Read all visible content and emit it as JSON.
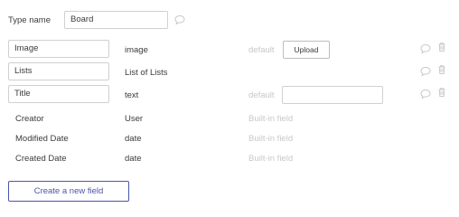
{
  "type_name": {
    "label": "Type name",
    "value": "Board"
  },
  "fields": [
    {
      "name": "Image",
      "type": "image",
      "default_label": "default",
      "has_upload": true
    },
    {
      "name": "Lists",
      "type": "List of Lists"
    },
    {
      "name": "Title",
      "type": "text",
      "default_label": "default",
      "default_value": ""
    }
  ],
  "builtin_fields": [
    {
      "name": "Creator",
      "type": "User",
      "note": "Built-in field"
    },
    {
      "name": "Modified Date",
      "type": "date",
      "note": "Built-in field"
    },
    {
      "name": "Created Date",
      "type": "date",
      "note": "Built-in field"
    }
  ],
  "upload_label": "Upload",
  "create_button_label": "Create a new field",
  "icons": {
    "comment": "comment-icon",
    "delete": "trash-icon"
  }
}
